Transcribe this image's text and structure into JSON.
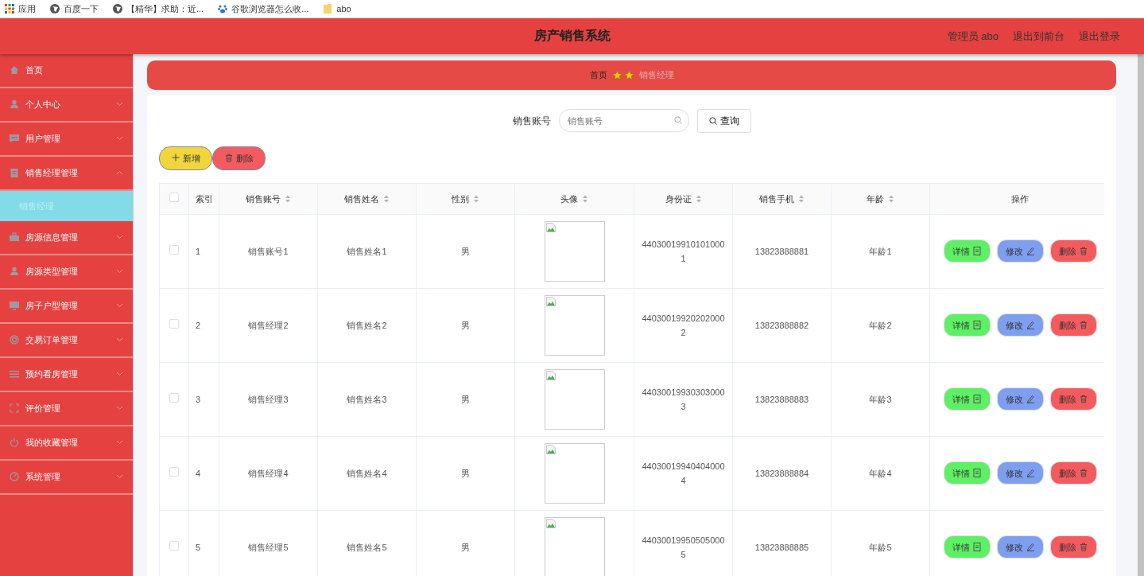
{
  "bookmarks": [
    {
      "label": "应用",
      "kind": "apps"
    },
    {
      "label": "百度一下",
      "kind": "globe"
    },
    {
      "label": "【精华】求助：近...",
      "kind": "globe"
    },
    {
      "label": "谷歌浏览器怎么收...",
      "kind": "paw"
    },
    {
      "label": "abo",
      "kind": "folder"
    }
  ],
  "header": {
    "title": "房产销售系统",
    "links": [
      "管理员 abo",
      "退出到前台",
      "退出登录"
    ]
  },
  "sidebar": {
    "items": [
      {
        "label": "首页"
      },
      {
        "label": "个人中心",
        "expanded": false
      },
      {
        "label": "用户管理",
        "expanded": false
      },
      {
        "label": "销售经理管理",
        "expanded": true,
        "children": [
          {
            "label": "销售经理",
            "selected": true
          }
        ]
      },
      {
        "label": "房源信息管理",
        "expanded": false
      },
      {
        "label": "房源类型管理",
        "expanded": false
      },
      {
        "label": "房子户型管理",
        "expanded": false
      },
      {
        "label": "交易订单管理",
        "expanded": false
      },
      {
        "label": "预约看房管理",
        "expanded": false
      },
      {
        "label": "评价管理",
        "expanded": false
      },
      {
        "label": "我的收藏管理",
        "expanded": false
      },
      {
        "label": "系统管理",
        "expanded": false
      }
    ]
  },
  "breadcrumb": [
    "首页",
    "销售经理"
  ],
  "search": {
    "label": "销售账号",
    "placeholder": "销售账号",
    "button": "查询"
  },
  "toolbar": [
    {
      "label": "新增",
      "kind": "add"
    },
    {
      "label": "删除",
      "kind": "delete"
    }
  ],
  "table": {
    "header_checked": false,
    "columns": [
      {
        "label": "索引",
        "sortable": false
      },
      {
        "label": "销售账号",
        "sortable": true
      },
      {
        "label": "销售姓名",
        "sortable": true
      },
      {
        "label": "性别",
        "sortable": true
      },
      {
        "label": "头像",
        "sortable": true
      },
      {
        "label": "身份证",
        "sortable": true
      },
      {
        "label": "销售手机",
        "sortable": true
      },
      {
        "label": "年龄",
        "sortable": true
      },
      {
        "label": "操作",
        "sortable": false
      }
    ],
    "rows": [
      {
        "checked": false,
        "cells": [
          "1",
          "销售账号1",
          "销售姓名1",
          "男",
          "",
          "440300199101010001",
          "13823888881",
          "年龄1"
        ],
        "actions": [
          {
            "label": "详情",
            "kind": "detail"
          },
          {
            "label": "修改",
            "kind": "edit"
          },
          {
            "label": "删除",
            "kind": "delete"
          }
        ]
      },
      {
        "checked": false,
        "cells": [
          "2",
          "销售经理2",
          "销售姓名2",
          "男",
          "",
          "440300199202020002",
          "13823888882",
          "年龄2"
        ],
        "actions": [
          {
            "label": "详情",
            "kind": "detail"
          },
          {
            "label": "修改",
            "kind": "edit"
          },
          {
            "label": "删除",
            "kind": "delete"
          }
        ]
      },
      {
        "checked": false,
        "cells": [
          "3",
          "销售经理3",
          "销售姓名3",
          "男",
          "",
          "440300199303030003",
          "13823888883",
          "年龄3"
        ],
        "actions": [
          {
            "label": "详情",
            "kind": "detail"
          },
          {
            "label": "修改",
            "kind": "edit"
          },
          {
            "label": "删除",
            "kind": "delete"
          }
        ]
      },
      {
        "checked": false,
        "cells": [
          "4",
          "销售经理4",
          "销售姓名4",
          "男",
          "",
          "440300199404040004",
          "13823888884",
          "年龄4"
        ],
        "actions": [
          {
            "label": "详情",
            "kind": "detail"
          },
          {
            "label": "修改",
            "kind": "edit"
          },
          {
            "label": "删除",
            "kind": "delete"
          }
        ]
      },
      {
        "checked": false,
        "cells": [
          "5",
          "销售经理5",
          "销售姓名5",
          "男",
          "",
          "440300199505050005",
          "13823888885",
          "年龄5"
        ],
        "actions": [
          {
            "label": "详情",
            "kind": "detail"
          },
          {
            "label": "修改",
            "kind": "edit"
          },
          {
            "label": "删除",
            "kind": "delete"
          }
        ]
      }
    ]
  }
}
